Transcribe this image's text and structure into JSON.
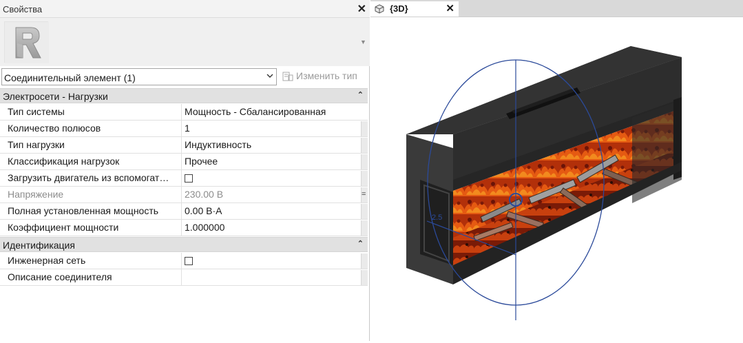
{
  "properties_panel": {
    "title": "Свойства",
    "close_symbol": "✕",
    "type_selector": {
      "value": "Соединительный элемент (1)",
      "edit_type_label": "Изменить тип"
    },
    "groups": [
      {
        "label": "Электросети - Нагрузки",
        "collapse_symbol": "⌃",
        "rows": [
          {
            "name": "Тип системы",
            "value": "Мощность - Сбалансированная"
          },
          {
            "name": "Количество полюсов",
            "value": "1"
          },
          {
            "name": "Тип нагрузки",
            "value": "Индуктивность"
          },
          {
            "name": "Классификация нагрузок",
            "value": "Прочее"
          },
          {
            "name": "Загрузить двигатель из вспомогат…",
            "value": ""
          },
          {
            "name": "Напряжение",
            "value": "230.00 В"
          },
          {
            "name": "Полная установленная мощность",
            "value": "0.00 В·А"
          },
          {
            "name": "Коэффициент мощности",
            "value": "1.000000"
          }
        ]
      },
      {
        "label": "Идентификация",
        "collapse_symbol": "⌃",
        "rows": [
          {
            "name": "Инженерная сеть",
            "value": ""
          },
          {
            "name": "Описание соединителя",
            "value": ""
          }
        ]
      }
    ]
  },
  "view": {
    "tab_label": "{3D}",
    "close_symbol": "✕",
    "dimension_label": "2.5"
  },
  "colors": {
    "accent_blue": "#2b4a9a",
    "fire": "#c4370c",
    "body": "#2f2f2f"
  }
}
